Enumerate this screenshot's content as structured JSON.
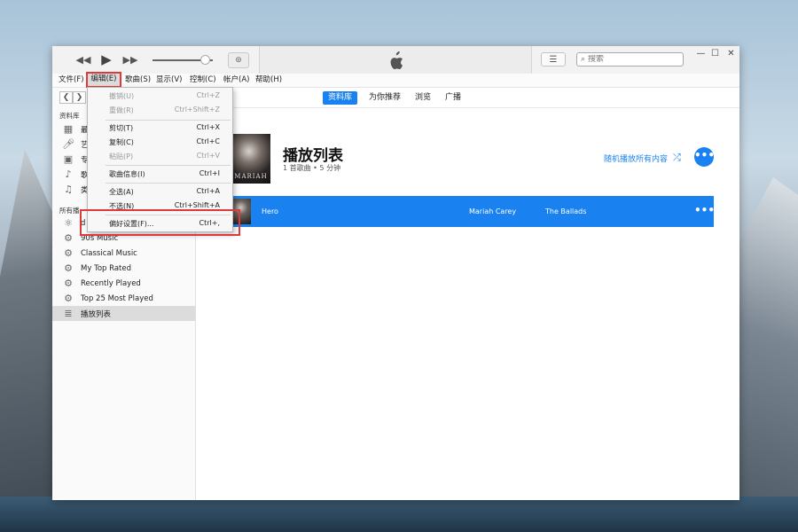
{
  "toolbar": {
    "rewind_icon": "rewind-icon",
    "play_icon": "play-icon",
    "forward_icon": "fast-forward-icon",
    "search_placeholder": "搜索",
    "volume_level": 0.88
  },
  "menubar": {
    "file": "文件(F)",
    "edit": "编辑(E)",
    "song": "歌曲(S)",
    "view": "显示(V)",
    "controls": "控制(C)",
    "account": "帐户(A)",
    "help": "帮助(H)"
  },
  "edit_menu": {
    "undo": {
      "label": "撤销(U)",
      "shortcut": "Ctrl+Z"
    },
    "redo": {
      "label": "重做(R)",
      "shortcut": "Ctrl+Shift+Z"
    },
    "cut": {
      "label": "剪切(T)",
      "shortcut": "Ctrl+X"
    },
    "copy": {
      "label": "复制(C)",
      "shortcut": "Ctrl+C"
    },
    "paste": {
      "label": "粘贴(P)",
      "shortcut": "Ctrl+V"
    },
    "song_info": {
      "label": "歌曲信息(I)",
      "shortcut": "Ctrl+I"
    },
    "select_all": {
      "label": "全选(A)",
      "shortcut": "Ctrl+A"
    },
    "select_none": {
      "label": "不选(N)",
      "shortcut": "Ctrl+Shift+A"
    },
    "preferences": {
      "label": "偏好设置(F)...",
      "shortcut": "Ctrl+,"
    }
  },
  "sidebar": {
    "library_heading": "资料库",
    "library_items": [
      {
        "label": "最",
        "icon": "grid-icon"
      },
      {
        "label": "艺",
        "icon": "microphone-icon"
      },
      {
        "label": "专",
        "icon": "album-icon"
      },
      {
        "label": "歌",
        "icon": "note-icon"
      },
      {
        "label": "类",
        "icon": "genre-icon"
      }
    ],
    "playlists_heading": "所有播",
    "playlists": [
      {
        "label": "90s Music",
        "icon": "gear-icon"
      },
      {
        "label": "Classical Music",
        "icon": "gear-icon"
      },
      {
        "label": "My Top Rated",
        "icon": "gear-icon"
      },
      {
        "label": "Recently Played",
        "icon": "gear-icon"
      },
      {
        "label": "Top 25 Most Played",
        "icon": "gear-icon"
      },
      {
        "label": "播放列表",
        "icon": "playlist-icon"
      }
    ],
    "partial_playlist_label": "d"
  },
  "tabs": {
    "library": "资料库",
    "for_you": "为你推荐",
    "browse": "浏览",
    "radio": "广播"
  },
  "playlist": {
    "title": "播放列表",
    "meta": "1 首歌曲 • 5 分钟",
    "shuffle_label": "随机播放所有内容",
    "artwork_text": "MARIAH",
    "more": "•••"
  },
  "tracks": [
    {
      "title": "Hero",
      "artist": "Mariah Carey",
      "album": "The Ballads",
      "more": "•••"
    }
  ]
}
